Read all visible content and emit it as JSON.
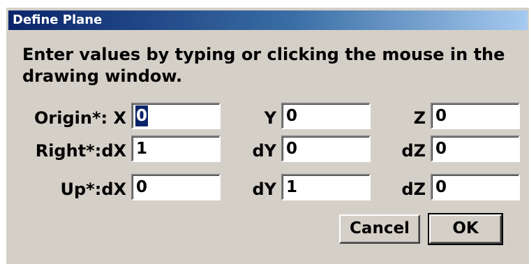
{
  "window": {
    "title": "Define Plane"
  },
  "instructions": "Enter values by typing or clicking the mouse in the drawing window.",
  "rows": [
    {
      "label": "Origin*: X",
      "fields": [
        {
          "label": "",
          "value": "0"
        },
        {
          "label": "Y",
          "value": "0"
        },
        {
          "label": "Z",
          "value": "0"
        }
      ]
    },
    {
      "label": "Right*:dX",
      "fields": [
        {
          "label": "",
          "value": "1"
        },
        {
          "label": "dY",
          "value": "0"
        },
        {
          "label": "dZ",
          "value": "0"
        }
      ]
    },
    {
      "label": "Up*:dX",
      "fields": [
        {
          "label": "",
          "value": "0"
        },
        {
          "label": "dY",
          "value": "1"
        },
        {
          "label": "dZ",
          "value": "0"
        }
      ]
    }
  ],
  "buttons": {
    "cancel": "Cancel",
    "ok": "OK"
  },
  "colors": {
    "dialog_bg": "#d4d0c8",
    "titlebar_start": "#0a246a",
    "titlebar_end": "#a6caf0",
    "selection": "#0a246a"
  }
}
